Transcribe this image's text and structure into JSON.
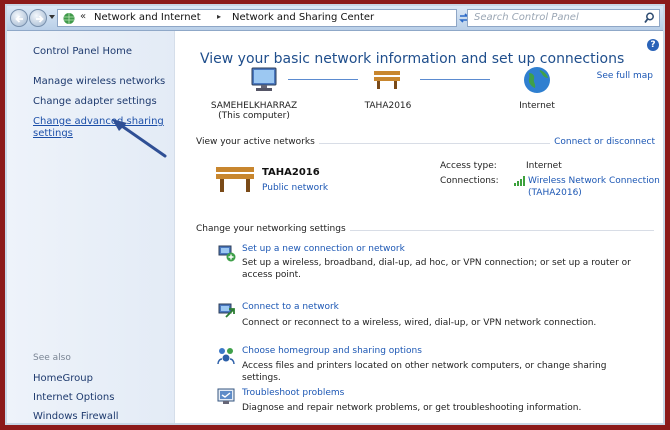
{
  "address_bar": {
    "crumb_prefix": "«",
    "crumb_1": "Network and Internet",
    "crumb_separator": "▸",
    "crumb_2": "Network and Sharing Center",
    "search_placeholder": "Search Control Panel"
  },
  "sidebar": {
    "home": "Control Panel Home",
    "links": [
      "Manage wireless networks",
      "Change adapter settings",
      "Change advanced sharing",
      "settings"
    ],
    "see_also_label": "See also",
    "see_also": [
      "HomeGroup",
      "Internet Options",
      "Windows Firewall"
    ]
  },
  "main": {
    "title": "View your basic network information and set up connections",
    "see_full_map": "See full map",
    "map_nodes": [
      {
        "name": "SAMEHELKHARRAZ",
        "sub": "(This computer)"
      },
      {
        "name": "TAHA2016",
        "sub": ""
      },
      {
        "name": "Internet",
        "sub": ""
      }
    ],
    "active_networks": {
      "heading": "View your active networks",
      "action": "Connect or disconnect",
      "network_name": "TAHA2016",
      "network_type": "Public network",
      "access_type_label": "Access type:",
      "access_type_value": "Internet",
      "connections_label": "Connections:",
      "connection_value_1": "Wireless Network Connection",
      "connection_value_2": "(TAHA2016)"
    },
    "settings_heading": "Change your networking settings",
    "tasks": [
      {
        "link": "Set up a new connection or network",
        "desc": "Set up a wireless, broadband, dial-up, ad hoc, or VPN connection; or set up a router or access point."
      },
      {
        "link": "Connect to a network",
        "desc": "Connect or reconnect to a wireless, wired, dial-up, or VPN network connection."
      },
      {
        "link": "Choose homegroup and sharing options",
        "desc": "Access files and printers located on other network computers, or change sharing settings."
      },
      {
        "link": "Troubleshoot problems",
        "desc": "Diagnose and repair network problems, or get troubleshooting information."
      }
    ]
  },
  "colors": {
    "frame_border": "#8c1a1a",
    "link": "#1c57b4",
    "title": "#1f4e8c"
  }
}
